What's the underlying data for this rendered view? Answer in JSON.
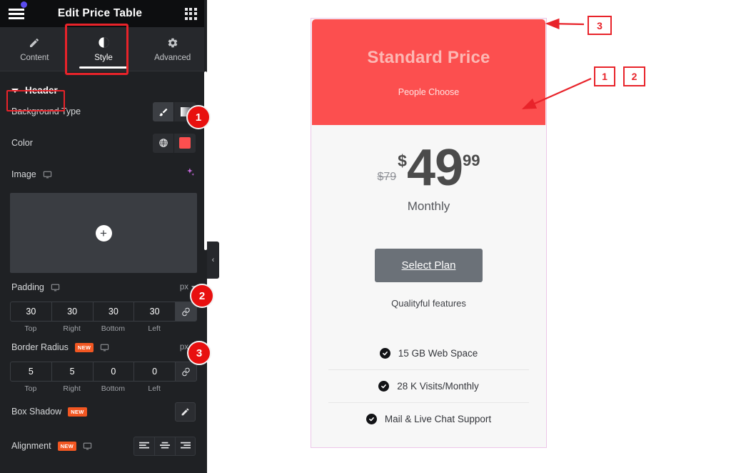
{
  "topbar": {
    "title": "Edit Price Table",
    "menu_icon": "hamburger-icon",
    "apps_icon": "grid-apps-icon"
  },
  "tabs": [
    {
      "label": "Content",
      "icon": "pencil-icon",
      "active": false
    },
    {
      "label": "Style",
      "icon": "contrast-icon",
      "active": true
    },
    {
      "label": "Advanced",
      "icon": "gear-icon",
      "active": false
    }
  ],
  "section": {
    "title": "Header",
    "expanded": true
  },
  "controls": {
    "background_type": {
      "label": "Background Type",
      "options": [
        {
          "icon": "brush-icon",
          "selected": true
        },
        {
          "icon": "gradient-icon",
          "selected": false
        }
      ]
    },
    "color": {
      "label": "Color",
      "globe_icon": "globe-icon",
      "value": "#fc4f4f"
    },
    "image": {
      "label": "Image",
      "device_icon": "monitor-icon",
      "ai_icon": "ai-sparkle-icon",
      "add_icon": "plus-icon"
    },
    "padding": {
      "label": "Padding",
      "device_icon": "monitor-icon",
      "unit": "px",
      "values": [
        "30",
        "30",
        "30",
        "30"
      ],
      "side_labels": [
        "Top",
        "Right",
        "Bottom",
        "Left"
      ],
      "link_icon": "link-icon",
      "linked": true
    },
    "border_radius": {
      "label": "Border Radius",
      "badge": "NEW",
      "device_icon": "monitor-icon",
      "unit": "px",
      "values": [
        "5",
        "5",
        "0",
        "0"
      ],
      "side_labels": [
        "Top",
        "Right",
        "Bottom",
        "Left"
      ],
      "link_icon": "link-icon",
      "linked": false
    },
    "box_shadow": {
      "label": "Box Shadow",
      "badge": "NEW",
      "edit_icon": "pencil-icon"
    },
    "alignment": {
      "label": "Alignment",
      "badge": "NEW",
      "device_icon": "monitor-icon",
      "options": [
        {
          "icon": "align-left-icon"
        },
        {
          "icon": "align-center-icon"
        },
        {
          "icon": "align-right-icon"
        }
      ]
    }
  },
  "collapse_handle": {
    "icon": "chevron-left-icon",
    "glyph": "‹"
  },
  "panel_badges": [
    {
      "number": "1"
    },
    {
      "number": "2"
    },
    {
      "number": "3"
    }
  ],
  "preview": {
    "header": {
      "title": "Standard Price",
      "subtitle": "People Choose",
      "bg_color": "#fc4f4f"
    },
    "price": {
      "original": "$79",
      "currency": "$",
      "integer": "49",
      "fraction": "99",
      "period": "Monthly"
    },
    "cta": {
      "label": "Select Plan"
    },
    "features_note": "Qualityful features",
    "features": [
      {
        "icon": "check-circle-icon",
        "label": "15 GB Web Space"
      },
      {
        "icon": "check-circle-icon",
        "label": "28 K Visits/Monthly"
      },
      {
        "icon": "check-circle-icon",
        "label": "Mail & Live Chat Support"
      }
    ]
  },
  "annotations": [
    {
      "number": "3"
    },
    {
      "number": "1"
    },
    {
      "number": "2"
    }
  ],
  "colors": {
    "accent_red": "#e8232a",
    "badge_red": "#e8100f",
    "panel_bg": "#1f2124",
    "card_red": "#fc4f4f",
    "new_badge": "#f25722"
  }
}
